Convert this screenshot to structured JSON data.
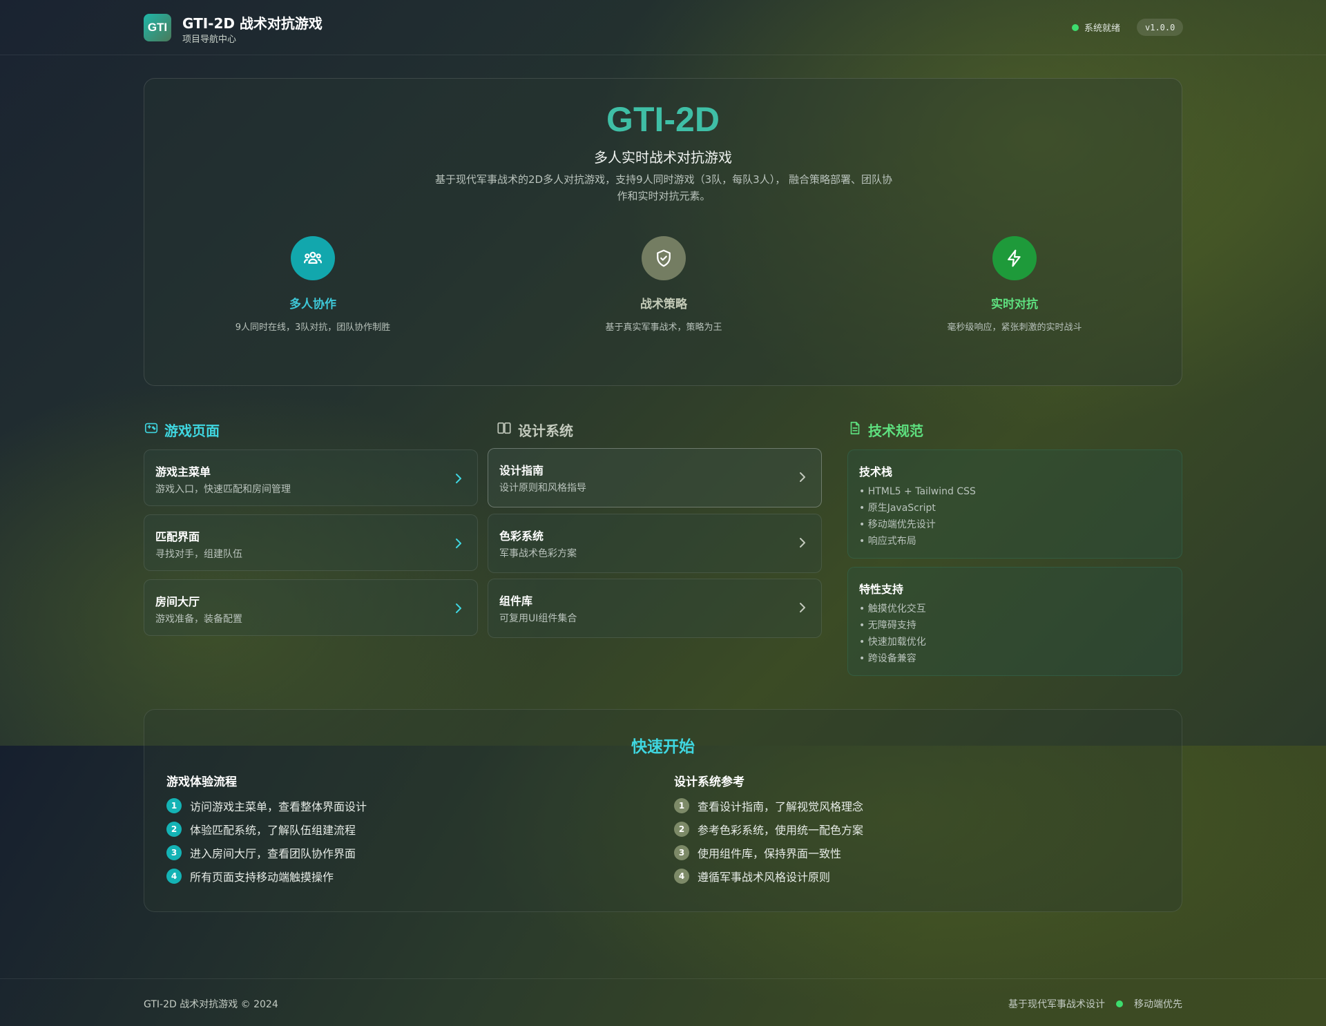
{
  "header": {
    "logo_text": "GTI",
    "title": "GTI-2D 战术对抗游戏",
    "subtitle": "项目导航中心",
    "status_text": "系统就绪",
    "version": "v1.0.0"
  },
  "hero": {
    "title": "GTI-2D",
    "subtitle": "多人实时战术对抗游戏",
    "description": "基于现代军事战术的2D多人对抗游戏，支持9人同时游戏（3队，每队3人）， 融合策略部署、团队协作和实时对抗元素。",
    "features": [
      {
        "title": "多人协作",
        "desc": "9人同时在线，3队对抗，团队协作制胜",
        "icon": "users-icon",
        "color": "#3ec8d8"
      },
      {
        "title": "战术策略",
        "desc": "基于真实军事战术，策略为王",
        "icon": "shield-check-icon",
        "color": "#c4cbb8"
      },
      {
        "title": "实时对抗",
        "desc": "毫秒级响应，紧张刺激的实时战斗",
        "icon": "lightning-icon",
        "color": "#5ee07f"
      }
    ]
  },
  "sections": {
    "game_pages": {
      "title": "游戏页面",
      "icon": "gamepad-icon",
      "color": "#3fd6e0",
      "items": [
        {
          "title": "游戏主菜单",
          "desc": "游戏入口，快速匹配和房间管理"
        },
        {
          "title": "匹配界面",
          "desc": "寻找对手，组建队伍"
        },
        {
          "title": "房间大厅",
          "desc": "游戏准备，装备配置"
        }
      ]
    },
    "design_system": {
      "title": "设计系统",
      "icon": "book-open-icon",
      "color": "#c3cabd",
      "items": [
        {
          "title": "设计指南",
          "desc": "设计原则和风格指导"
        },
        {
          "title": "色彩系统",
          "desc": "军事战术色彩方案"
        },
        {
          "title": "组件库",
          "desc": "可复用UI组件集合"
        }
      ]
    },
    "tech_spec": {
      "title": "技术规范",
      "icon": "document-icon",
      "color": "#5ee07f",
      "blocks": [
        {
          "title": "技术栈",
          "items": [
            "• HTML5 + Tailwind CSS",
            "• 原生JavaScript",
            "• 移动端优先设计",
            "• 响应式布局"
          ]
        },
        {
          "title": "特性支持",
          "items": [
            "• 触摸优化交互",
            "• 无障碍支持",
            "• 快速加载优化",
            "• 跨设备兼容"
          ]
        }
      ]
    }
  },
  "quick_start": {
    "title": "快速开始",
    "flow": {
      "title": "游戏体验流程",
      "badge_color": "#14b3b5",
      "steps": [
        {
          "n": "1",
          "text": "访问游戏主菜单，查看整体界面设计"
        },
        {
          "n": "2",
          "text": "体验匹配系统，了解队伍组建流程"
        },
        {
          "n": "3",
          "text": "进入房间大厅，查看团队协作界面"
        },
        {
          "n": "4",
          "text": "所有页面支持移动端触摸操作"
        }
      ]
    },
    "reference": {
      "title": "设计系统参考",
      "badge_color": "#7d8a68",
      "steps": [
        {
          "n": "1",
          "text": "查看设计指南，了解视觉风格理念"
        },
        {
          "n": "2",
          "text": "参考色彩系统，使用统一配色方案"
        },
        {
          "n": "3",
          "text": "使用组件库，保持界面一致性"
        },
        {
          "n": "4",
          "text": "遵循军事战术风格设计原则"
        }
      ]
    }
  },
  "footer": {
    "copyright": "GTI-2D 战术对抗游戏 © 2024",
    "note_left": "基于现代军事战术设计",
    "note_right": "移动端优先"
  }
}
